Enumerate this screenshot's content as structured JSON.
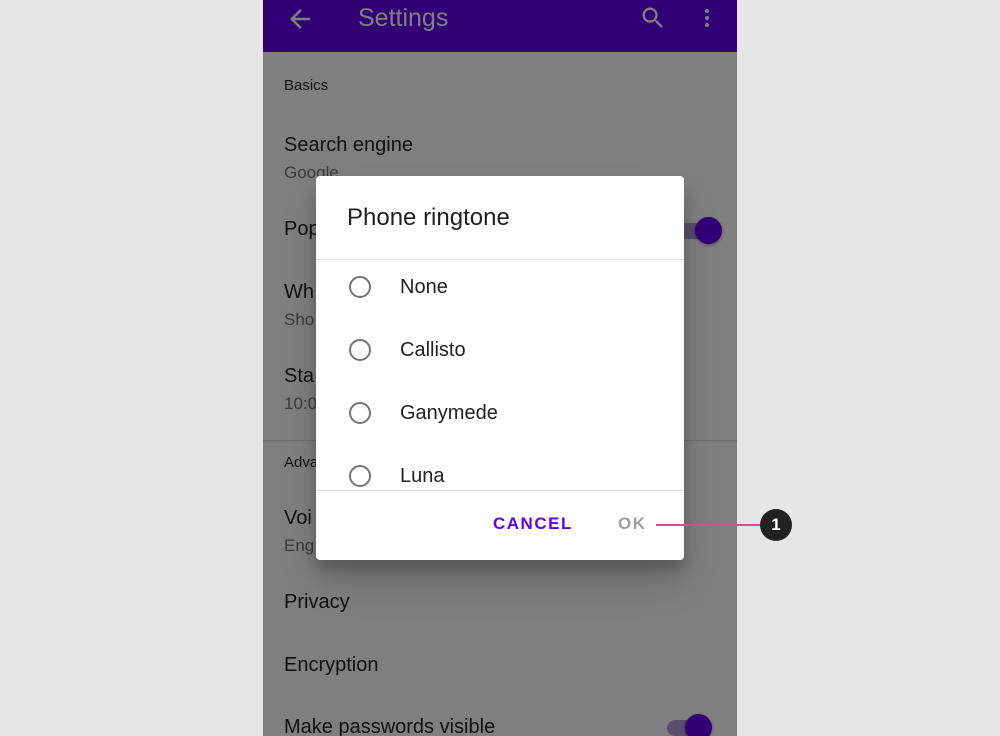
{
  "appbar": {
    "title": "Settings",
    "back_icon": "arrow-back-icon",
    "search_icon": "search-icon",
    "more_icon": "more-vert-icon",
    "color": "#6200ee"
  },
  "settings": {
    "section_basics": "Basics",
    "search_engine": {
      "title": "Search engine",
      "value": "Google"
    },
    "popups_title_partial": "Pop",
    "wh_title_partial": "Wh",
    "wh_sub_partial": "Sho",
    "sta_title_partial": "Sta",
    "sta_sub_partial": "10:0",
    "section_advanced_partial": "Adva",
    "voi_title_partial": "Voi",
    "voi_sub_partial": "Eng",
    "privacy": "Privacy",
    "encryption": "Encryption",
    "make_passwords_visible": "Make passwords visible"
  },
  "dialog": {
    "title": "Phone ringtone",
    "options": [
      {
        "label": "None",
        "selected": false
      },
      {
        "label": "Callisto",
        "selected": false
      },
      {
        "label": "Ganymede",
        "selected": false
      },
      {
        "label": "Luna",
        "selected": false
      }
    ],
    "cancel_label": "CANCEL",
    "ok_label": "OK"
  },
  "callout": {
    "number": "1",
    "color": "#e4498a"
  }
}
